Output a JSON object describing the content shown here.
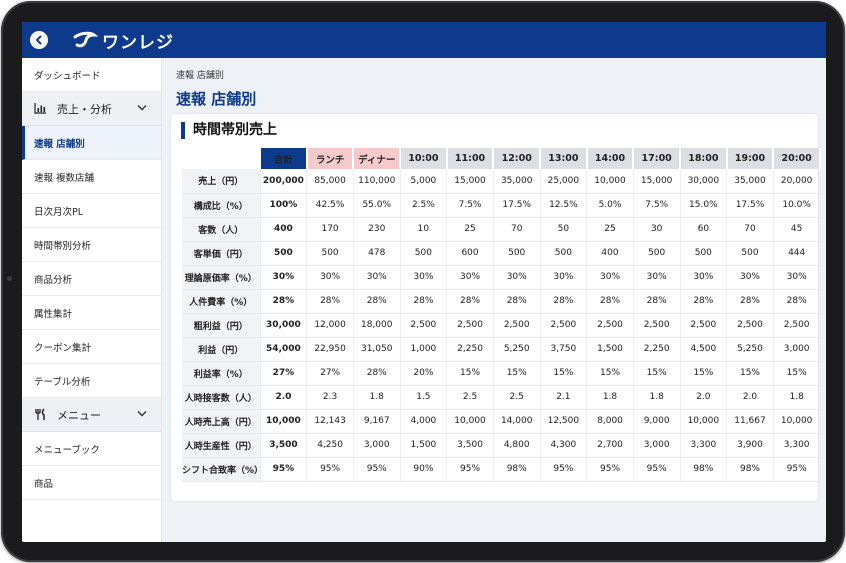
{
  "app": {
    "logo_text": "ワンレジ"
  },
  "sidebar": {
    "dashboard": "ダッシュボード",
    "group_sales": "売上・分析",
    "items": [
      "速報 店舗別",
      "速報 複数店舗",
      "日次月次PL",
      "時間帯別分析",
      "商品分析",
      "属性集計",
      "クーポン集計",
      "テーブル分析"
    ],
    "group_menu": "メニュー",
    "menu_items": [
      "メニューブック",
      "商品"
    ]
  },
  "main": {
    "breadcrumb": "速報 店舗別",
    "title": "速報 店舗別",
    "card_title": "時間帯別売上"
  },
  "table": {
    "columns": [
      "合計",
      "ランチ",
      "ディナー",
      "10:00",
      "11:00",
      "12:00",
      "13:00",
      "14:00",
      "17:00",
      "18:00",
      "19:00",
      "20:00"
    ],
    "rows": [
      {
        "label": "売上（円）",
        "values": [
          "200,000",
          "85,000",
          "110,000",
          "5,000",
          "15,000",
          "35,000",
          "25,000",
          "10,000",
          "15,000",
          "30,000",
          "35,000",
          "20,000"
        ]
      },
      {
        "label": "構成比（%）",
        "values": [
          "100%",
          "42.5%",
          "55.0%",
          "2.5%",
          "7.5%",
          "17.5%",
          "12.5%",
          "5.0%",
          "7.5%",
          "15.0%",
          "17.5%",
          "10.0%"
        ]
      },
      {
        "label": "客数（人）",
        "values": [
          "400",
          "170",
          "230",
          "10",
          "25",
          "70",
          "50",
          "25",
          "30",
          "60",
          "70",
          "45"
        ]
      },
      {
        "label": "客単価（円）",
        "values": [
          "500",
          "500",
          "478",
          "500",
          "600",
          "500",
          "500",
          "400",
          "500",
          "500",
          "500",
          "444"
        ]
      },
      {
        "label": "理論原価率（%）",
        "values": [
          "30%",
          "30%",
          "30%",
          "30%",
          "30%",
          "30%",
          "30%",
          "30%",
          "30%",
          "30%",
          "30%",
          "30%"
        ]
      },
      {
        "label": "人件費率（%）",
        "values": [
          "28%",
          "28%",
          "28%",
          "28%",
          "28%",
          "28%",
          "28%",
          "28%",
          "28%",
          "28%",
          "28%",
          "28%"
        ]
      },
      {
        "label": "粗利益（円）",
        "values": [
          "30,000",
          "12,000",
          "18,000",
          "2,500",
          "2,500",
          "2,500",
          "2,500",
          "2,500",
          "2,500",
          "2,500",
          "2,500",
          "2,500"
        ]
      },
      {
        "label": "利益（円）",
        "values": [
          "54,000",
          "22,950",
          "31,050",
          "1,000",
          "2,250",
          "5,250",
          "3,750",
          "1,500",
          "2,250",
          "4,500",
          "5,250",
          "3,000"
        ]
      },
      {
        "label": "利益率（%）",
        "values": [
          "27%",
          "27%",
          "28%",
          "20%",
          "15%",
          "15%",
          "15%",
          "15%",
          "15%",
          "15%",
          "15%",
          "15%"
        ]
      },
      {
        "label": "人時接客数（人）",
        "values": [
          "2.0",
          "2.3",
          "1.8",
          "1.5",
          "2.5",
          "2.5",
          "2.1",
          "1.8",
          "1.8",
          "2.0",
          "2.0",
          "1.8"
        ]
      },
      {
        "label": "人時売上高（円）",
        "values": [
          "10,000",
          "12,143",
          "9,167",
          "4,000",
          "10,000",
          "14,000",
          "12,500",
          "8,000",
          "9,000",
          "10,000",
          "11,667",
          "10,000"
        ]
      },
      {
        "label": "人時生産性（円）",
        "values": [
          "3,500",
          "4,250",
          "3,000",
          "1,500",
          "3,500",
          "4,800",
          "4,300",
          "2,700",
          "3,000",
          "3,300",
          "3,900",
          "3,300"
        ]
      },
      {
        "label": "シフト合致率（%）",
        "values": [
          "95%",
          "95%",
          "95%",
          "90%",
          "95%",
          "98%",
          "95%",
          "95%",
          "95%",
          "98%",
          "98%",
          "95%"
        ]
      }
    ]
  },
  "colors": {
    "brand": "#0d3a8c",
    "meal_header": "#f6c9cb",
    "hour_header": "#dcdee3"
  }
}
